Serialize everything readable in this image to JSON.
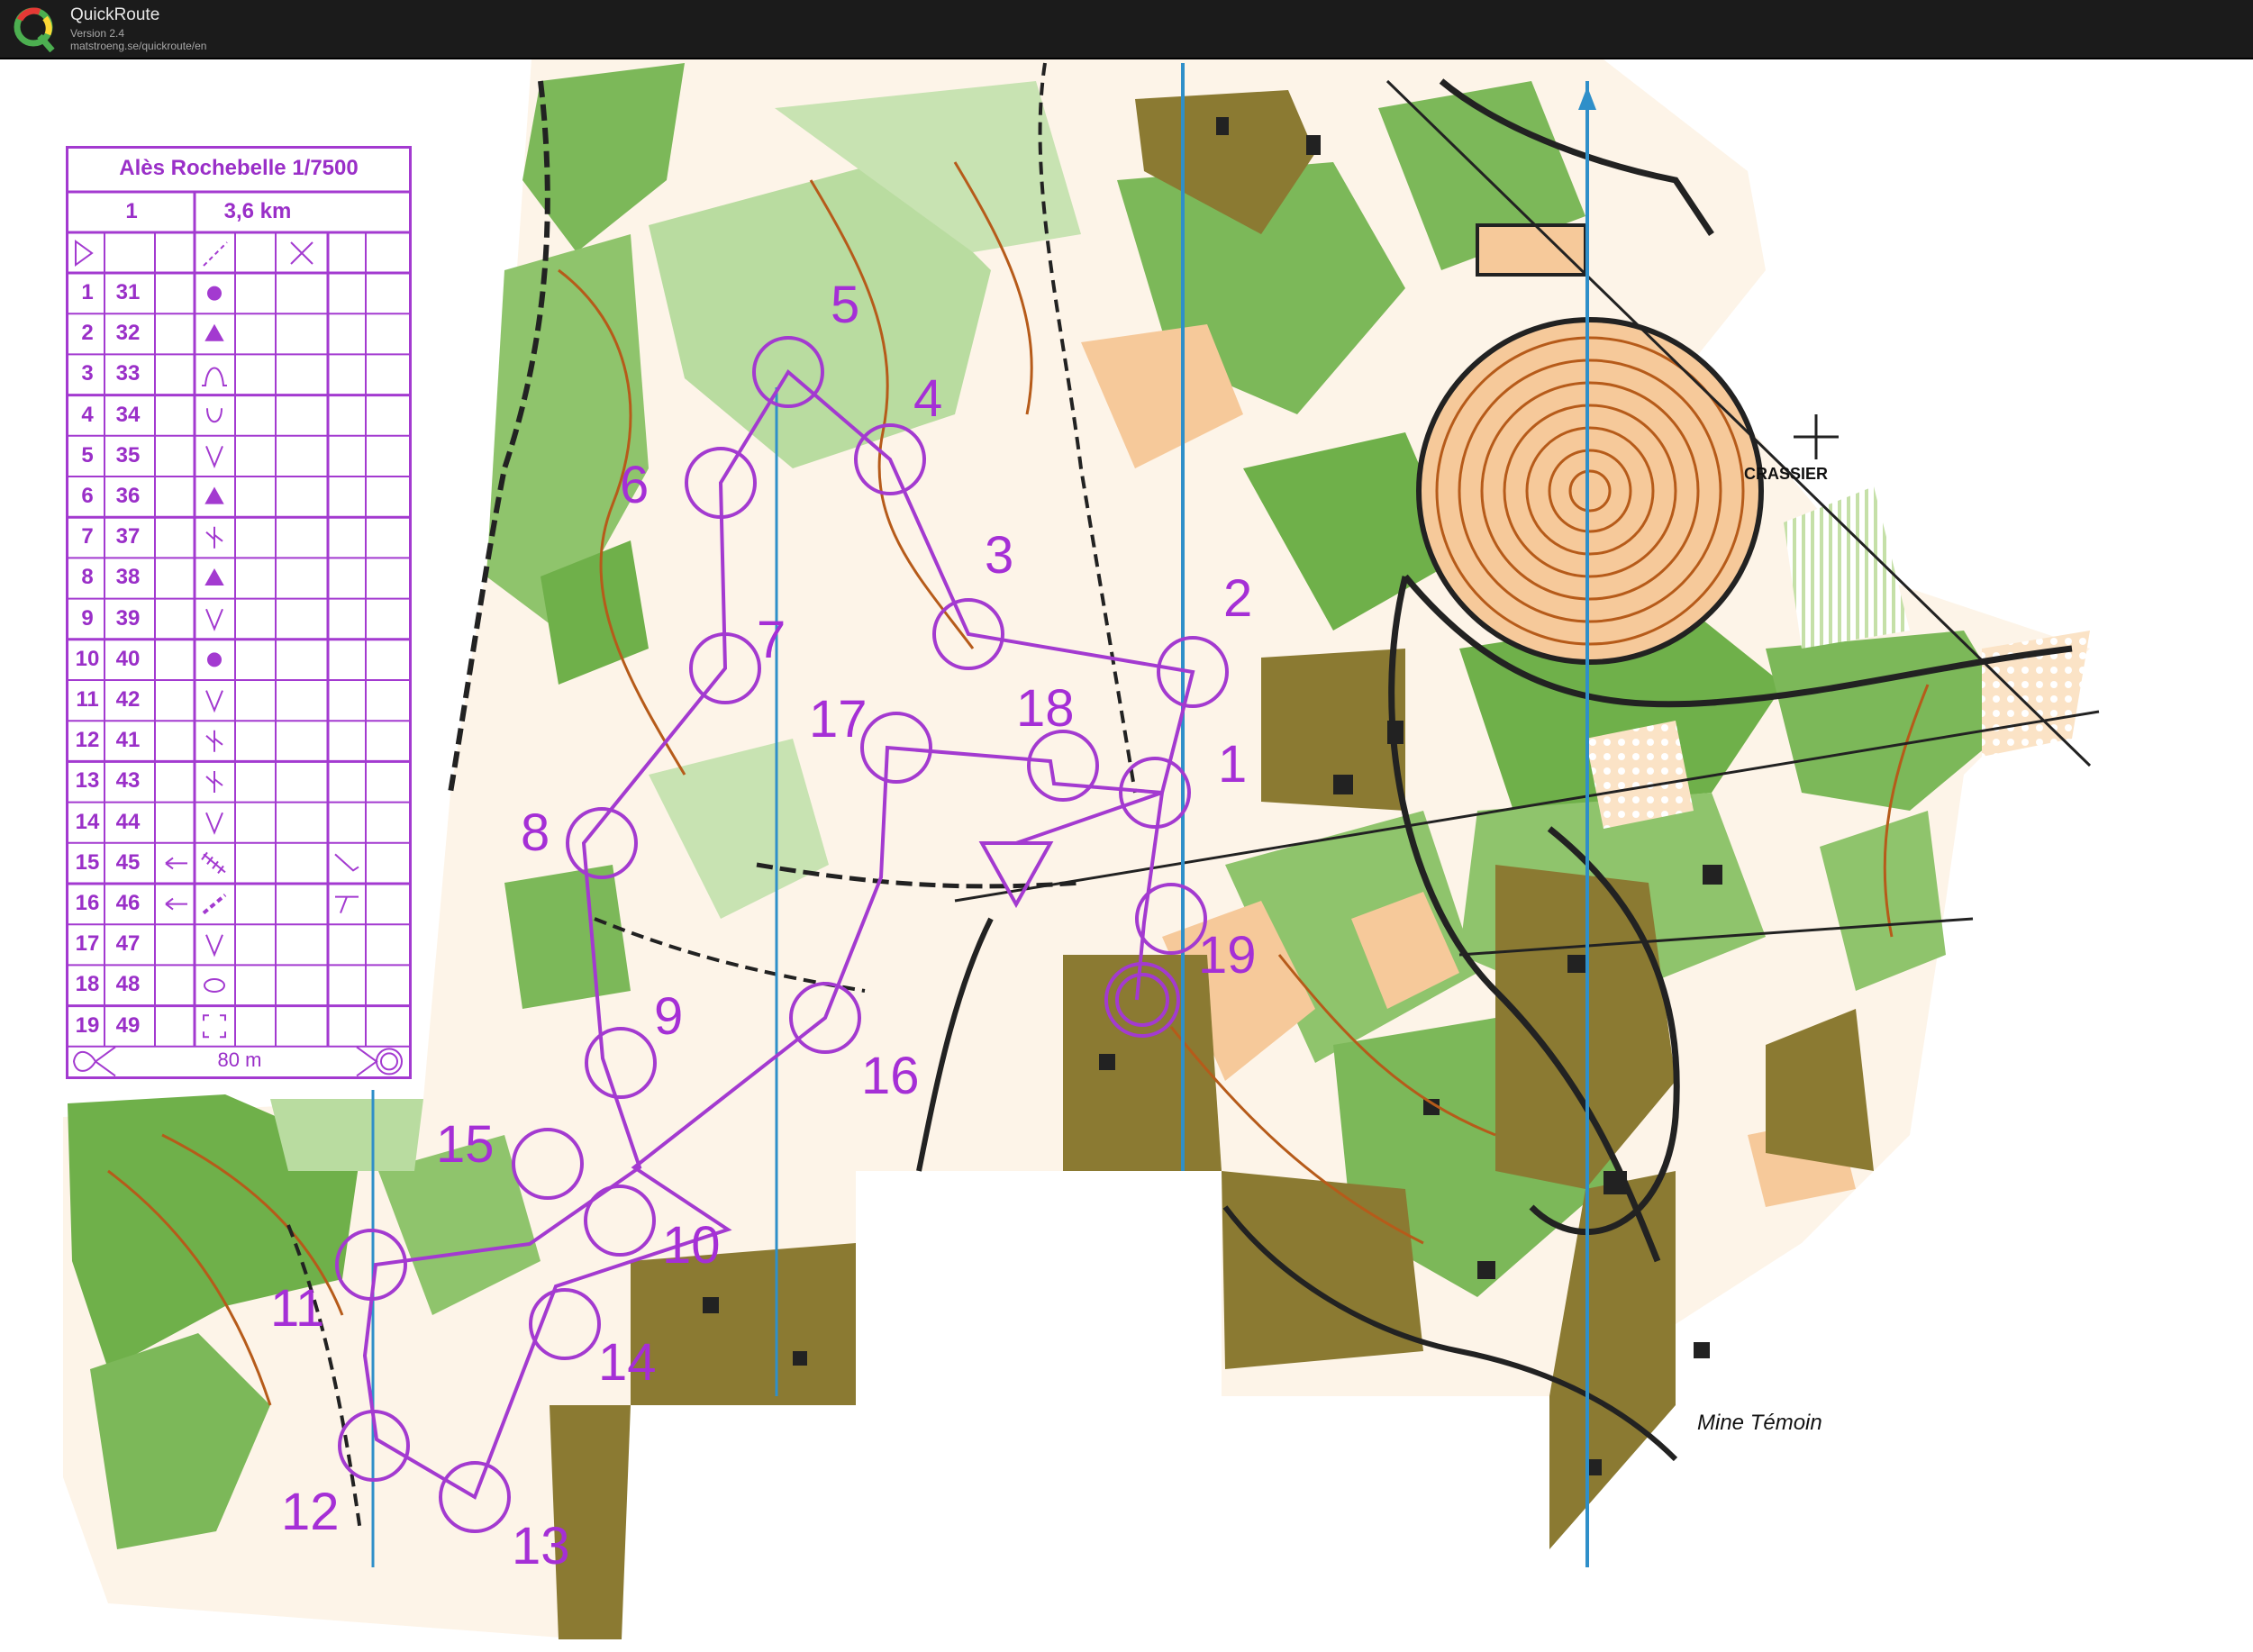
{
  "app": {
    "name": "QuickRoute",
    "version": "Version 2.4",
    "url": "matstroeng.se/quickroute/en"
  },
  "colors": {
    "titlebar": "#1b1b1b",
    "course_overprint": "#a33ad0",
    "forest_green": "#6fb04a",
    "light_green": "#b9dca0",
    "open_land": "#f6c99a",
    "olive_private": "#8b7a32",
    "contour_brown": "#b65b1a",
    "water_blue": "#2f8fc9"
  },
  "control_card": {
    "title": "Alès Rochebelle 1/7500",
    "course": "1",
    "length": "3,6 km",
    "finish_distance": "80 m",
    "controls": [
      {
        "num": "1",
        "code": "31",
        "symbol": "dot-icon"
      },
      {
        "num": "2",
        "code": "32",
        "symbol": "triangle-icon"
      },
      {
        "num": "3",
        "code": "33",
        "symbol": "hill-icon"
      },
      {
        "num": "4",
        "code": "34",
        "symbol": "depression-icon"
      },
      {
        "num": "5",
        "code": "35",
        "symbol": "reentrant-icon"
      },
      {
        "num": "6",
        "code": "36",
        "symbol": "triangle-icon"
      },
      {
        "num": "7",
        "code": "37",
        "symbol": "gully-junction-icon"
      },
      {
        "num": "8",
        "code": "38",
        "symbol": "triangle-icon"
      },
      {
        "num": "9",
        "code": "39",
        "symbol": "reentrant-icon"
      },
      {
        "num": "10",
        "code": "40",
        "symbol": "dot-icon"
      },
      {
        "num": "11",
        "code": "42",
        "symbol": "reentrant-icon"
      },
      {
        "num": "12",
        "code": "41",
        "symbol": "gully-junction-icon"
      },
      {
        "num": "13",
        "code": "43",
        "symbol": "gully-junction-icon"
      },
      {
        "num": "14",
        "code": "44",
        "symbol": "reentrant-icon"
      },
      {
        "num": "15",
        "code": "45",
        "symbol": "stairway-icon"
      },
      {
        "num": "16",
        "code": "46",
        "symbol": "path-icon"
      },
      {
        "num": "17",
        "code": "47",
        "symbol": "reentrant-icon"
      },
      {
        "num": "18",
        "code": "48",
        "symbol": "ellipse-icon"
      },
      {
        "num": "19",
        "code": "49",
        "symbol": "corner-box-icon"
      }
    ]
  },
  "map_labels": {
    "crassier": "CRASSIER",
    "mine": "Mine Témoin"
  },
  "course_controls": [
    "1",
    "2",
    "3",
    "4",
    "5",
    "6",
    "7",
    "8",
    "9",
    "10",
    "11",
    "12",
    "13",
    "14",
    "15",
    "16",
    "17",
    "18",
    "19"
  ]
}
